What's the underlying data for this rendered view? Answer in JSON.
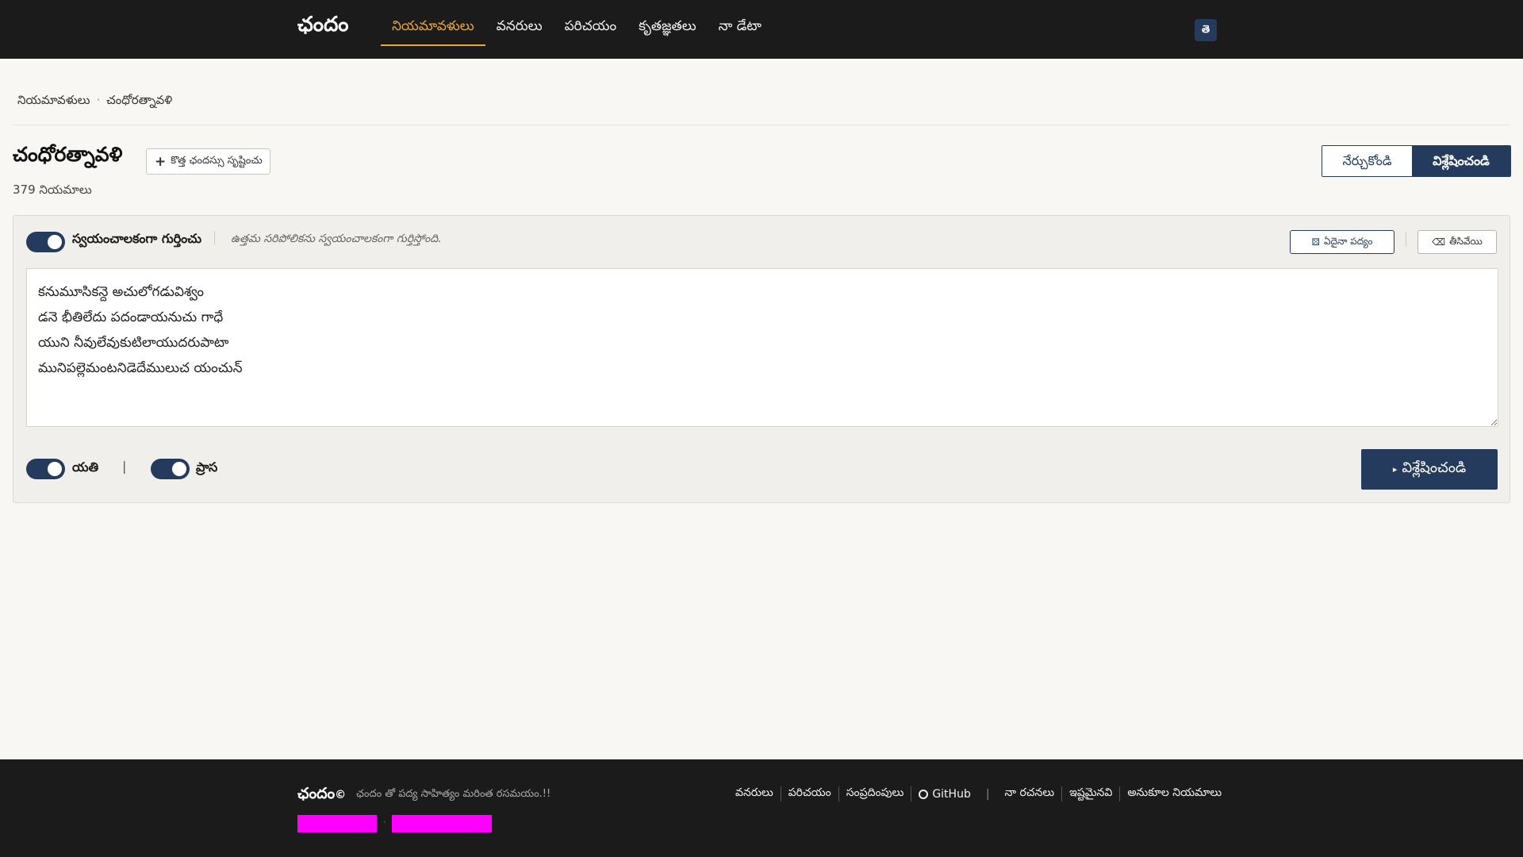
{
  "header": {
    "brand": "ఛందం",
    "nav": [
      "నియమావళులు",
      "వనరులు",
      "పరిచయం",
      "కృతజ్ఞతలు",
      "నా డేటా"
    ],
    "lang": "తె"
  },
  "breadcrumb": {
    "root": "నియమావళులు",
    "current": "చంధోరత్నావళి"
  },
  "page": {
    "title": "చంధోరత్నావళి",
    "new_button": "కొత్త ఛందస్సు సృష్టించు",
    "count": "379 నియమాలు",
    "mode_learn": "నేర్చుకోండి",
    "mode_analyze": "విశ్లేషించండి"
  },
  "panel": {
    "auto_label": "స్వయంచాలకంగా గుర్తించు",
    "auto_hint": "ఉత్తమ సరిపోలికను స్వయంచాలకంగా గుర్తిస్తోంది.",
    "example_button": "ఏదైనా పద్యం",
    "clear_button": "తీసివేయి",
    "poem": "కనుమూసికన్దె అచులోగడువిశ్వం\nడనె భీతిలేదు పదండాయనుచు గాధే\nయుని నీవులేవుకుటిలాయుదరుపాటా\nమునిపల్లెమంటనిడెదేములుచ యంచున్",
    "yati_label": "యతి",
    "pipe": "|",
    "prasa_label": "ప్రాస",
    "analyze_button": "విశ్లేషించండి"
  },
  "footer": {
    "brand": "ఛందం",
    "tagline": "ఛందం తో పద్య సాహిత్యం మరింత రసమయం.!!",
    "links_left": [
      "వనరులు",
      "పరిచయం",
      "సంప్రదింపులు"
    ],
    "github": "GitHub",
    "links_right": [
      "నా రచనలు",
      "ఇష్టమైనవి",
      "అనుకూల నియమాలు"
    ]
  },
  "colors": {
    "accent": "#243b5e",
    "nav_active": "#e8a838",
    "redacted": "#ff00ff"
  }
}
